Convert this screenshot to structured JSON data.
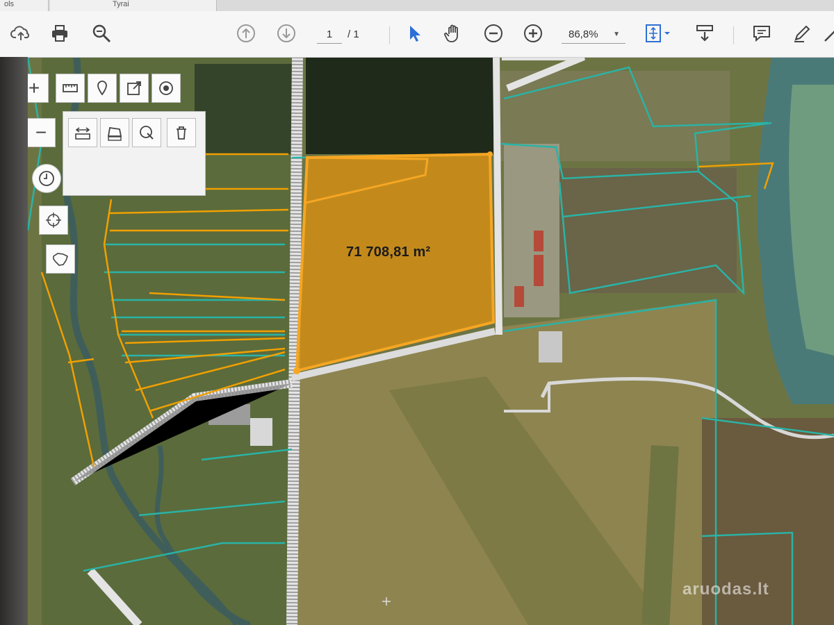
{
  "tabs": [
    {
      "label": "ols"
    },
    {
      "label": "Tyrai"
    }
  ],
  "toolbar": {
    "page_current": "1",
    "page_total": "/ 1",
    "zoom": "86,8%",
    "icons": [
      "upload-icon",
      "print-icon",
      "search-icon",
      "prev-page-icon",
      "next-page-icon",
      "select-arrow-icon",
      "hand-icon",
      "zoom-out-icon",
      "zoom-in-icon",
      "fit-page-icon",
      "scroll-mode-icon",
      "comment-icon",
      "pen-icon",
      "share-icon"
    ]
  },
  "map_tools": {
    "zoom_in": "+",
    "zoom_out": "−",
    "icons": [
      "measure-icon",
      "marker-icon",
      "export-icon",
      "point-icon",
      "measure-distance-icon",
      "measure-area-icon",
      "clear-measure-icon",
      "trash-icon",
      "clock-icon",
      "locate-icon",
      "lithuania-outline-icon"
    ]
  },
  "map": {
    "area_label": "71 708,81 m²",
    "watermark": "aruodas.lt",
    "colors": {
      "parcel_fill": "#d58f12",
      "parcel_border": "#f5a623",
      "cadastre_line": "#2ab3a6",
      "road": "#e8e8e8"
    }
  }
}
